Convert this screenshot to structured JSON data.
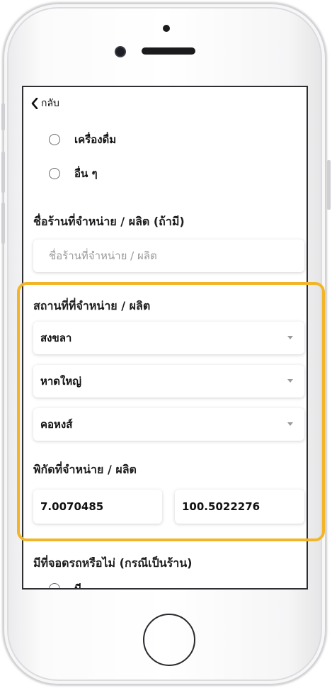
{
  "nav": {
    "back_label": "กลับ",
    "back_icon": "chevron-left-icon"
  },
  "product_type": {
    "options": [
      {
        "label": "เครื่องดื่ม",
        "selected": false
      },
      {
        "label": "อื่น ๆ",
        "selected": false
      }
    ]
  },
  "shop_name": {
    "label": "ชื่อร้านที่จำหน่าย / ผลิต (ถ้ามี)",
    "placeholder": "ชื่อร้านที่จำหน่าย / ผลิต",
    "value": ""
  },
  "location": {
    "label": "สถานที่ที่จำหน่าย / ผลิต",
    "province": "สงขลา",
    "district": "หาดใหญ่",
    "subdistrict": "คอหงส์"
  },
  "coordinates": {
    "label": "พิกัดที่จำหน่าย / ผลิต",
    "latitude": "7.0070485",
    "longitude": "100.5022276"
  },
  "parking": {
    "label": "มีที่จอดรถหรือไม่ (กรณีเป็นร้าน)",
    "options": [
      {
        "label": "มี",
        "selected": false
      }
    ]
  },
  "colors": {
    "highlight": "#f2b52a",
    "text": "#111111",
    "placeholder": "#9a9a9a"
  }
}
